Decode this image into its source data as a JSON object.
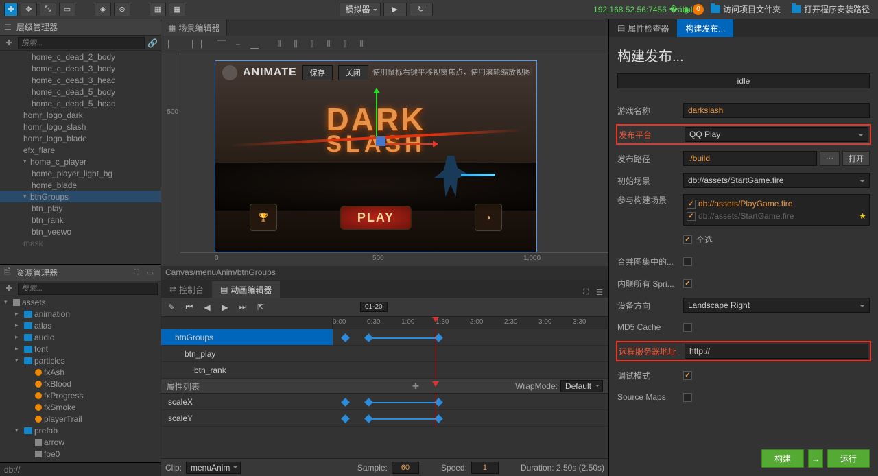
{
  "toolbar": {
    "simulator": "模拟器",
    "ip": "192.168.52.56:7456",
    "badge": "0",
    "folder_link": "访问项目文件夹",
    "install_link": "打开程序安装路径"
  },
  "hierarchy": {
    "title": "层级管理器",
    "search_placeholder": "搜索...",
    "items": [
      {
        "label": "home_c_dead_2_body",
        "indent": 46
      },
      {
        "label": "home_c_dead_3_body",
        "indent": 46
      },
      {
        "label": "home_c_dead_3_head",
        "indent": 46
      },
      {
        "label": "home_c_dead_5_body",
        "indent": 46
      },
      {
        "label": "home_c_dead_5_head",
        "indent": 46
      },
      {
        "label": "homr_logo_dark",
        "indent": 34
      },
      {
        "label": "homr_logo_slash",
        "indent": 34
      },
      {
        "label": "homr_logo_blade",
        "indent": 34
      },
      {
        "label": "efx_flare",
        "indent": 34
      },
      {
        "label": "home_c_player",
        "indent": 34,
        "arrow": "▾"
      },
      {
        "label": "home_player_light_bg",
        "indent": 46
      },
      {
        "label": "home_blade",
        "indent": 46
      },
      {
        "label": "btnGroups",
        "indent": 34,
        "arrow": "▾",
        "sel": true
      },
      {
        "label": "btn_play",
        "indent": 46
      },
      {
        "label": "btn_rank",
        "indent": 46
      },
      {
        "label": "btn_veewo",
        "indent": 46
      },
      {
        "label": "mask",
        "indent": 34,
        "dim": true
      }
    ]
  },
  "assets": {
    "title": "资源管理器",
    "search_placeholder": "搜索...",
    "items": [
      {
        "label": "assets",
        "indent": 6,
        "icon": "cube",
        "arrow": "▾"
      },
      {
        "label": "animation",
        "indent": 22,
        "icon": "folder",
        "arrow": "▸"
      },
      {
        "label": "atlas",
        "indent": 22,
        "icon": "folder",
        "arrow": "▸"
      },
      {
        "label": "audio",
        "indent": 22,
        "icon": "folder",
        "arrow": "▸"
      },
      {
        "label": "font",
        "indent": 22,
        "icon": "folder",
        "arrow": "▸"
      },
      {
        "label": "particles",
        "indent": 22,
        "icon": "folder",
        "arrow": "▾"
      },
      {
        "label": "fxAsh",
        "indent": 38,
        "icon": "fire"
      },
      {
        "label": "fxBlood",
        "indent": 38,
        "icon": "fire"
      },
      {
        "label": "fxProgress",
        "indent": 38,
        "icon": "fire"
      },
      {
        "label": "fxSmoke",
        "indent": 38,
        "icon": "fire"
      },
      {
        "label": "playerTrail",
        "indent": 38,
        "icon": "fire"
      },
      {
        "label": "prefab",
        "indent": 22,
        "icon": "folder",
        "arrow": "▾"
      },
      {
        "label": "arrow",
        "indent": 38,
        "icon": "cube"
      },
      {
        "label": "foe0",
        "indent": 38,
        "icon": "cube"
      }
    ]
  },
  "status_bar": "db://",
  "scene": {
    "tab": "场景编辑器",
    "animate": "ANIMATE",
    "save": "保存",
    "close": "关闭",
    "hint": "使用鼠标右键平移视窗焦点，使用滚轮缩放视图",
    "logo_dark": "DARK",
    "logo_slash": "SLASH",
    "play": "PLAY",
    "ruler_v": "500",
    "ruler_h": [
      "0",
      "500",
      "1,000"
    ]
  },
  "breadcrumb": "Canvas/menuAnim/btnGroups",
  "console": {
    "tab_console": "控制台",
    "tab_anim": "动画编辑器",
    "frame": "01-20",
    "ticks": [
      "0:00",
      "0:30",
      "1:00",
      "1:30",
      "2:00",
      "2:30",
      "3:00",
      "3:30"
    ],
    "tracks": [
      "btnGroups",
      "btn_play",
      "btn_rank"
    ],
    "props_header": "属性列表",
    "wrap_label": "WrapMode:",
    "wrap_value": "Default",
    "props": [
      "scaleX",
      "scaleY"
    ],
    "clip_label": "Clip:",
    "clip_value": "menuAnim",
    "sample_label": "Sample:",
    "sample_value": "60",
    "speed_label": "Speed:",
    "speed_value": "1",
    "duration": "Duration: 2.50s (2.50s)"
  },
  "inspector": {
    "tab_inspector": "属性检查器",
    "tab_build": "构建发布...",
    "title": "构建发布...",
    "idle": "idle",
    "game_name_label": "游戏名称",
    "game_name": "darkslash",
    "platform_label": "发布平台",
    "platform": "QQ Play",
    "path_label": "发布路径",
    "path": "./build",
    "path_browse": "···",
    "path_open": "打开",
    "start_scene_label": "初始场景",
    "start_scene": "db://assets/StartGame.fire",
    "scenes_label": "参与构建场景",
    "scene1": "db://assets/PlayGame.fire",
    "scene2": "db://assets/StartGame.fire",
    "select_all": "全选",
    "merge_label": "合并图集中的...",
    "inline_label": "内联所有 Spri...",
    "orient_label": "设备方向",
    "orient": "Landscape Right",
    "md5_label": "MD5 Cache",
    "remote_label": "远程服务器地址",
    "remote": "http://",
    "debug_label": "调试模式",
    "sourcemap_label": "Source Maps",
    "build_btn": "构建",
    "run_btn": "运行"
  }
}
